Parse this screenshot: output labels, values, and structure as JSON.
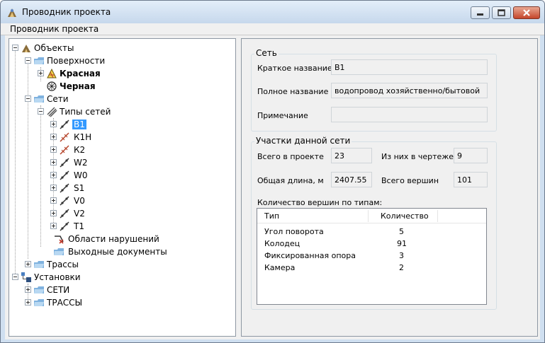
{
  "window": {
    "title": "Проводник проекта"
  },
  "menu": {
    "items": [
      "Проводник проекта"
    ]
  },
  "tree": {
    "objects": "Объекты",
    "surfaces": "Поверхности",
    "surface_items": [
      "Красная",
      "Черная"
    ],
    "networks": "Сети",
    "network_types": "Типы сетей",
    "network_items": [
      "В1",
      "К1Н",
      "К2",
      "W2",
      "W0",
      "S1",
      "V0",
      "V2",
      "T1"
    ],
    "violation_areas": "Области нарушений",
    "output_docs": "Выходные документы",
    "routes": "Трассы",
    "settings": "Установки",
    "settings_items": [
      "СЕТИ",
      "ТРАССЫ"
    ]
  },
  "net_group": {
    "title": "Сеть",
    "short_name_label": "Краткое название",
    "short_name_value": "В1",
    "full_name_label": "Полное название",
    "full_name_value": "водопровод хозяйственно/бытовой",
    "note_label": "Примечание",
    "note_value": ""
  },
  "sections_group": {
    "title": "Участки данной сети",
    "total_label": "Всего в проекте",
    "total_value": "23",
    "in_drawing_label": "Из них в чертеже",
    "in_drawing_value": "9",
    "length_label": "Общая длина, м",
    "length_value": "2407.55",
    "vertices_label": "Всего вершин",
    "vertices_value": "101",
    "by_type_label": "Количество вершин по типам:",
    "columns": [
      "Тип",
      "Количество"
    ],
    "rows": [
      {
        "type": "Угол поворота",
        "count": "5"
      },
      {
        "type": "Колодец",
        "count": "91"
      },
      {
        "type": "Фиксированная опора",
        "count": "3"
      },
      {
        "type": "Камера",
        "count": "2"
      }
    ]
  },
  "colors": {
    "selection": "#3399ff",
    "title_bar": "#c6d8ec",
    "close_button": "#c5462b"
  }
}
